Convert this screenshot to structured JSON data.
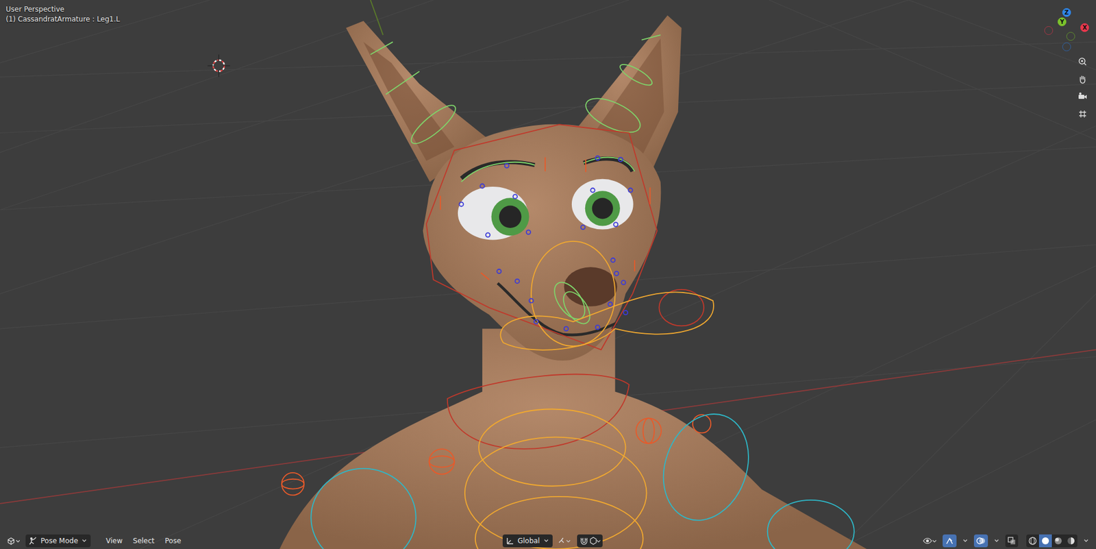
{
  "viewport": {
    "title": "User Perspective",
    "object": "(1) CassandratArmature : Leg1.L"
  },
  "gizmo": {
    "axes": [
      {
        "label": "Z",
        "color": "#2f86e8",
        "positive": true
      },
      {
        "label": "Y",
        "color": "#7cc22c",
        "positive": true
      },
      {
        "label": "X",
        "color": "#e8374d",
        "positive": true
      },
      {
        "label": "",
        "color": "#c8364a",
        "positive": false
      },
      {
        "label": "",
        "color": "#6aa82a",
        "positive": false
      },
      {
        "label": "",
        "color": "#2a6cc0",
        "positive": false
      }
    ]
  },
  "header": {
    "mode": "Pose Mode",
    "menus": [
      "View",
      "Select",
      "Pose"
    ],
    "orientation": "Global",
    "snapping": false,
    "overlays": true,
    "gizmos": true,
    "xray": false,
    "shading": [
      {
        "name": "wireframe",
        "selected": false
      },
      {
        "name": "solid",
        "selected": true
      },
      {
        "name": "material",
        "selected": false
      },
      {
        "name": "rendered",
        "selected": false
      }
    ]
  }
}
